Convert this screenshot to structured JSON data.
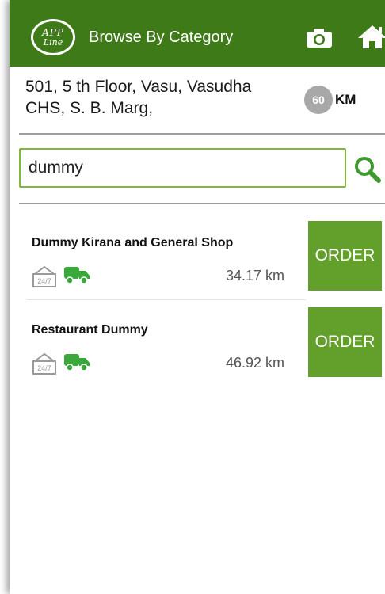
{
  "header": {
    "logo_line1": "APP",
    "logo_line2": "Line",
    "title": "Browse By Category",
    "icons": [
      "camera-icon",
      "home-icon"
    ]
  },
  "location": {
    "address": "501, 5 th Floor, Vasu, Vasudha CHS, S. B. Marg,",
    "radius": "60",
    "unit": "KM"
  },
  "search": {
    "value": "dummy",
    "icon": "search-icon"
  },
  "stores": [
    {
      "name": "Dummy Kirana and General Shop",
      "distance": "34.17 km",
      "badge": "24/7",
      "order_label": "ORDER"
    },
    {
      "name": "Restaurant Dummy",
      "distance": "46.92 km",
      "badge": "24/7",
      "order_label": "ORDER"
    }
  ],
  "colors": {
    "header_bg": "#3f7a18",
    "order_bg": "#62a02b",
    "search_border": "#7fb93a",
    "truck": "#3aa83a"
  }
}
